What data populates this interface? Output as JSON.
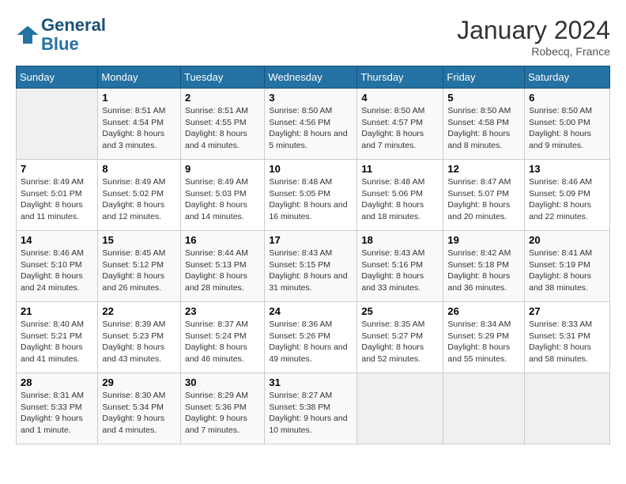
{
  "header": {
    "logo_line1": "General",
    "logo_line2": "Blue",
    "month_year": "January 2024",
    "location": "Robecq, France"
  },
  "weekdays": [
    "Sunday",
    "Monday",
    "Tuesday",
    "Wednesday",
    "Thursday",
    "Friday",
    "Saturday"
  ],
  "weeks": [
    [
      {
        "day": "",
        "sunrise": "",
        "sunset": "",
        "daylight": ""
      },
      {
        "day": "1",
        "sunrise": "Sunrise: 8:51 AM",
        "sunset": "Sunset: 4:54 PM",
        "daylight": "Daylight: 8 hours and 3 minutes."
      },
      {
        "day": "2",
        "sunrise": "Sunrise: 8:51 AM",
        "sunset": "Sunset: 4:55 PM",
        "daylight": "Daylight: 8 hours and 4 minutes."
      },
      {
        "day": "3",
        "sunrise": "Sunrise: 8:50 AM",
        "sunset": "Sunset: 4:56 PM",
        "daylight": "Daylight: 8 hours and 5 minutes."
      },
      {
        "day": "4",
        "sunrise": "Sunrise: 8:50 AM",
        "sunset": "Sunset: 4:57 PM",
        "daylight": "Daylight: 8 hours and 7 minutes."
      },
      {
        "day": "5",
        "sunrise": "Sunrise: 8:50 AM",
        "sunset": "Sunset: 4:58 PM",
        "daylight": "Daylight: 8 hours and 8 minutes."
      },
      {
        "day": "6",
        "sunrise": "Sunrise: 8:50 AM",
        "sunset": "Sunset: 5:00 PM",
        "daylight": "Daylight: 8 hours and 9 minutes."
      }
    ],
    [
      {
        "day": "7",
        "sunrise": "Sunrise: 8:49 AM",
        "sunset": "Sunset: 5:01 PM",
        "daylight": "Daylight: 8 hours and 11 minutes."
      },
      {
        "day": "8",
        "sunrise": "Sunrise: 8:49 AM",
        "sunset": "Sunset: 5:02 PM",
        "daylight": "Daylight: 8 hours and 12 minutes."
      },
      {
        "day": "9",
        "sunrise": "Sunrise: 8:49 AM",
        "sunset": "Sunset: 5:03 PM",
        "daylight": "Daylight: 8 hours and 14 minutes."
      },
      {
        "day": "10",
        "sunrise": "Sunrise: 8:48 AM",
        "sunset": "Sunset: 5:05 PM",
        "daylight": "Daylight: 8 hours and 16 minutes."
      },
      {
        "day": "11",
        "sunrise": "Sunrise: 8:48 AM",
        "sunset": "Sunset: 5:06 PM",
        "daylight": "Daylight: 8 hours and 18 minutes."
      },
      {
        "day": "12",
        "sunrise": "Sunrise: 8:47 AM",
        "sunset": "Sunset: 5:07 PM",
        "daylight": "Daylight: 8 hours and 20 minutes."
      },
      {
        "day": "13",
        "sunrise": "Sunrise: 8:46 AM",
        "sunset": "Sunset: 5:09 PM",
        "daylight": "Daylight: 8 hours and 22 minutes."
      }
    ],
    [
      {
        "day": "14",
        "sunrise": "Sunrise: 8:46 AM",
        "sunset": "Sunset: 5:10 PM",
        "daylight": "Daylight: 8 hours and 24 minutes."
      },
      {
        "day": "15",
        "sunrise": "Sunrise: 8:45 AM",
        "sunset": "Sunset: 5:12 PM",
        "daylight": "Daylight: 8 hours and 26 minutes."
      },
      {
        "day": "16",
        "sunrise": "Sunrise: 8:44 AM",
        "sunset": "Sunset: 5:13 PM",
        "daylight": "Daylight: 8 hours and 28 minutes."
      },
      {
        "day": "17",
        "sunrise": "Sunrise: 8:43 AM",
        "sunset": "Sunset: 5:15 PM",
        "daylight": "Daylight: 8 hours and 31 minutes."
      },
      {
        "day": "18",
        "sunrise": "Sunrise: 8:43 AM",
        "sunset": "Sunset: 5:16 PM",
        "daylight": "Daylight: 8 hours and 33 minutes."
      },
      {
        "day": "19",
        "sunrise": "Sunrise: 8:42 AM",
        "sunset": "Sunset: 5:18 PM",
        "daylight": "Daylight: 8 hours and 36 minutes."
      },
      {
        "day": "20",
        "sunrise": "Sunrise: 8:41 AM",
        "sunset": "Sunset: 5:19 PM",
        "daylight": "Daylight: 8 hours and 38 minutes."
      }
    ],
    [
      {
        "day": "21",
        "sunrise": "Sunrise: 8:40 AM",
        "sunset": "Sunset: 5:21 PM",
        "daylight": "Daylight: 8 hours and 41 minutes."
      },
      {
        "day": "22",
        "sunrise": "Sunrise: 8:39 AM",
        "sunset": "Sunset: 5:23 PM",
        "daylight": "Daylight: 8 hours and 43 minutes."
      },
      {
        "day": "23",
        "sunrise": "Sunrise: 8:37 AM",
        "sunset": "Sunset: 5:24 PM",
        "daylight": "Daylight: 8 hours and 46 minutes."
      },
      {
        "day": "24",
        "sunrise": "Sunrise: 8:36 AM",
        "sunset": "Sunset: 5:26 PM",
        "daylight": "Daylight: 8 hours and 49 minutes."
      },
      {
        "day": "25",
        "sunrise": "Sunrise: 8:35 AM",
        "sunset": "Sunset: 5:27 PM",
        "daylight": "Daylight: 8 hours and 52 minutes."
      },
      {
        "day": "26",
        "sunrise": "Sunrise: 8:34 AM",
        "sunset": "Sunset: 5:29 PM",
        "daylight": "Daylight: 8 hours and 55 minutes."
      },
      {
        "day": "27",
        "sunrise": "Sunrise: 8:33 AM",
        "sunset": "Sunset: 5:31 PM",
        "daylight": "Daylight: 8 hours and 58 minutes."
      }
    ],
    [
      {
        "day": "28",
        "sunrise": "Sunrise: 8:31 AM",
        "sunset": "Sunset: 5:33 PM",
        "daylight": "Daylight: 9 hours and 1 minute."
      },
      {
        "day": "29",
        "sunrise": "Sunrise: 8:30 AM",
        "sunset": "Sunset: 5:34 PM",
        "daylight": "Daylight: 9 hours and 4 minutes."
      },
      {
        "day": "30",
        "sunrise": "Sunrise: 8:29 AM",
        "sunset": "Sunset: 5:36 PM",
        "daylight": "Daylight: 9 hours and 7 minutes."
      },
      {
        "day": "31",
        "sunrise": "Sunrise: 8:27 AM",
        "sunset": "Sunset: 5:38 PM",
        "daylight": "Daylight: 9 hours and 10 minutes."
      },
      {
        "day": "",
        "sunrise": "",
        "sunset": "",
        "daylight": ""
      },
      {
        "day": "",
        "sunrise": "",
        "sunset": "",
        "daylight": ""
      },
      {
        "day": "",
        "sunrise": "",
        "sunset": "",
        "daylight": ""
      }
    ]
  ]
}
